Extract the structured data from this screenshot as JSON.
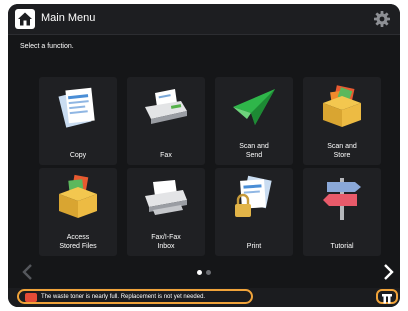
{
  "header": {
    "title": "Main Menu"
  },
  "subtitle": "Select a function.",
  "tiles": [
    {
      "label": "Copy"
    },
    {
      "label": "Fax"
    },
    {
      "label": "Scan and\nSend"
    },
    {
      "label": "Scan and\nStore"
    },
    {
      "label": "Access\nStored Files"
    },
    {
      "label": "Fax/I-Fax\nInbox"
    },
    {
      "label": "Print"
    },
    {
      "label": "Tutorial"
    }
  ],
  "pagination": {
    "current_page": 1,
    "page_count": 2
  },
  "status": {
    "message": "The waste toner is nearly full. Replacement is not yet needed."
  },
  "colors": {
    "accent": "#f0a33a",
    "warning": "#e34b37",
    "background": "#151618",
    "tile": "#1f2023"
  }
}
